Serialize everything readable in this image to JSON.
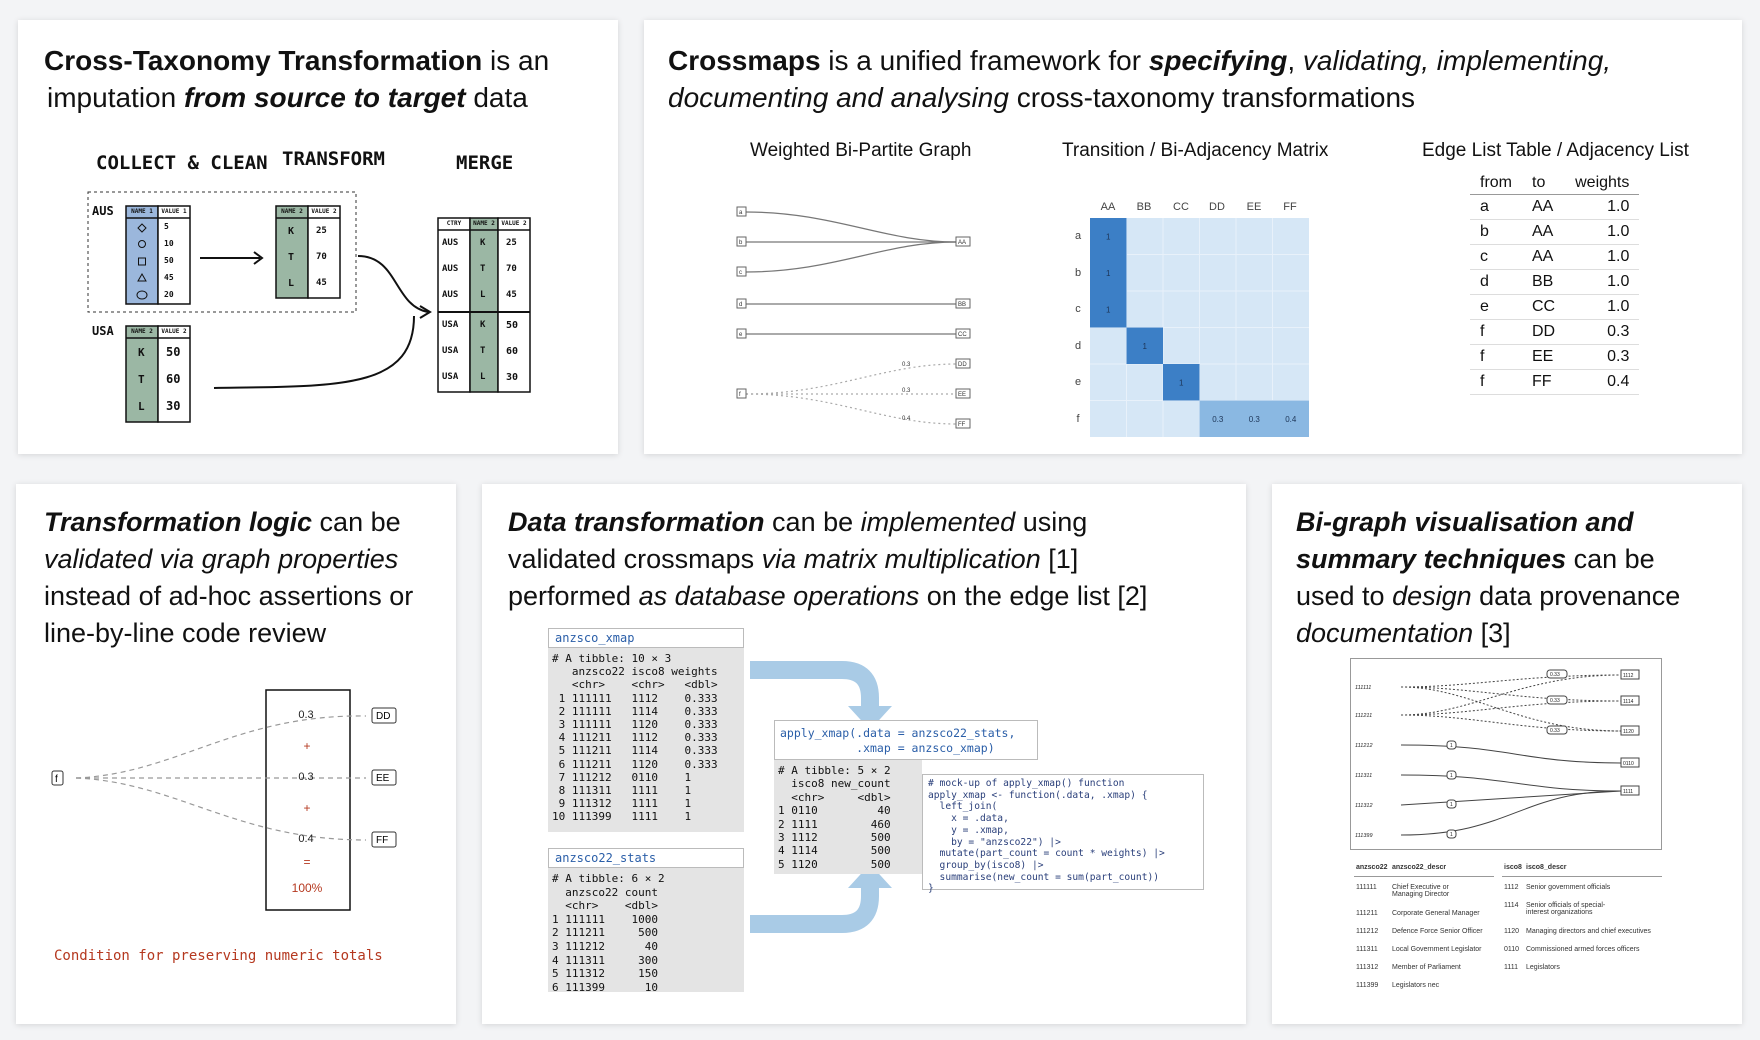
{
  "panel1": {
    "title_strong": "Cross-Taxonomy Transformation",
    "title_rest1": " is an",
    "title_rest2": "imputation ",
    "title_em": "from source to target",
    "title_rest3": " data",
    "stage_collect": "COLLECT & CLEAN",
    "stage_transform": "TRANSFORM",
    "stage_merge": "MERGE",
    "label_aus": "AUS",
    "label_usa": "USA",
    "col_name1": "NAME 1",
    "col_value1": "VALUE 1",
    "col_name2": "NAME 2",
    "col_value2": "VALUE 2",
    "col_ctry": "CTRY",
    "aus_values": [
      "5",
      "10",
      "50",
      "45",
      "20"
    ],
    "aus_transformed": [
      {
        "k": "K",
        "v": "25"
      },
      {
        "k": "T",
        "v": "70"
      },
      {
        "k": "L",
        "v": "45"
      }
    ],
    "usa_rows": [
      {
        "k": "K",
        "v": "50"
      },
      {
        "k": "T",
        "v": "60"
      },
      {
        "k": "L",
        "v": "30"
      }
    ],
    "merge_rows": [
      {
        "c": "AUS",
        "k": "K",
        "v": "25"
      },
      {
        "c": "AUS",
        "k": "T",
        "v": "70"
      },
      {
        "c": "AUS",
        "k": "L",
        "v": "45"
      },
      {
        "c": "USA",
        "k": "K",
        "v": "50"
      },
      {
        "c": "USA",
        "k": "T",
        "v": "60"
      },
      {
        "c": "USA",
        "k": "L",
        "v": "30"
      }
    ]
  },
  "panel2": {
    "title_strong": "Crossmaps",
    "title_a": " is a unified framework for ",
    "title_b": "specifying",
    "title_c": ", ",
    "title_d": "validating, implementing,",
    "title_e": "documenting and analysing",
    "title_f": " cross-taxonomy transformations",
    "graph_title": "Weighted Bi-Partite Graph",
    "matrix_title": "Transition / Bi-Adjacency Matrix",
    "table_title": "Edge List Table / Adjacency List",
    "sources": [
      "a",
      "b",
      "c",
      "d",
      "e",
      "f"
    ],
    "targets": [
      "AA",
      "BB",
      "CC",
      "DD",
      "EE",
      "FF"
    ],
    "edge_weights_f": [
      "0.3",
      "0.3",
      "0.4"
    ],
    "matrix_cells": [
      {
        "r": 0,
        "c": 0,
        "v": "1"
      },
      {
        "r": 1,
        "c": 0,
        "v": "1"
      },
      {
        "r": 2,
        "c": 0,
        "v": "1"
      },
      {
        "r": 3,
        "c": 1,
        "v": "1"
      },
      {
        "r": 4,
        "c": 2,
        "v": "1"
      },
      {
        "r": 5,
        "c": 3,
        "v": "0.3"
      },
      {
        "r": 5,
        "c": 4,
        "v": "0.3"
      },
      {
        "r": 5,
        "c": 5,
        "v": "0.4"
      }
    ],
    "edge_table_headers": [
      "from",
      "to",
      "weights"
    ],
    "edge_table_rows": [
      [
        "a",
        "AA",
        "1.0"
      ],
      [
        "b",
        "AA",
        "1.0"
      ],
      [
        "c",
        "AA",
        "1.0"
      ],
      [
        "d",
        "BB",
        "1.0"
      ],
      [
        "e",
        "CC",
        "1.0"
      ],
      [
        "f",
        "DD",
        "0.3"
      ],
      [
        "f",
        "EE",
        "0.3"
      ],
      [
        "f",
        "FF",
        "0.4"
      ]
    ]
  },
  "panel3": {
    "l1_strong": "Transformation logic",
    "l1_rest": " can be",
    "l2_em": "validated via graph properties",
    "l3": "instead of ad-hoc assertions or",
    "l4": "line-by-line code review",
    "source_node": "f",
    "targets": [
      "DD",
      "EE",
      "FF"
    ],
    "weights": [
      "0.3",
      "0.3",
      "0.4"
    ],
    "plus": "+",
    "equals": "=",
    "total": "100%",
    "caption": "Condition for preserving numeric totals"
  },
  "panel4": {
    "l1_strong": "Data transformation",
    "l1_a": " can be ",
    "l1_em": "implemented",
    "l1_b": " using",
    "l2_a": "validated crossmaps ",
    "l2_em": "via matrix multiplication",
    "l2_b": " [1]",
    "l3_a": "performed ",
    "l3_em": "as database operations",
    "l3_b": " on the edge list [2]",
    "xmap_header": "anzsco_xmap",
    "xmap_body": "# A tibble: 10 × 3\n   anzsco22 isco8 weights\n   <chr>    <chr>   <dbl>\n 1 111111   1112    0.333\n 2 111111   1114    0.333\n 3 111111   1120    0.333\n 4 111211   1112    0.333\n 5 111211   1114    0.333\n 6 111211   1120    0.333\n 7 111212   0110    1\n 8 111311   1111    1\n 9 111312   1111    1\n10 111399   1111    1",
    "stats_header": "anzsco22_stats",
    "stats_body": "# A tibble: 6 × 2\n  anzsco22 count\n  <chr>    <dbl>\n1 111111    1000\n2 111211     500\n3 111212      40\n4 111311     300\n5 111312     150\n6 111399      10",
    "call_l1": "apply_xmap(.data = anzsco22_stats,",
    "call_l2": "           .xmap = anzsco_xmap)",
    "result_body": "# A tibble: 5 × 2\n  isco8 new_count\n  <chr>     <dbl>\n1 0110         40\n2 1111        460\n3 1112        500\n4 1114        500\n5 1120        500",
    "fn_body": "# mock-up of apply_xmap() function\napply_xmap <- function(.data, .xmap) {\n  left_join(\n    x = .data,\n    y = .xmap,\n    by = \"anzsco22\") |>\n  mutate(part_count = count * weights) |>\n  group_by(isco8) |>\n  summarise(new_count = sum(part_count))\n}"
  },
  "panel5": {
    "l1_bi": "Bi-graph visualisation and",
    "l2_bi": "summary techniques",
    "l2_rest": " can be",
    "l3_a": "used to ",
    "l3_em": "design",
    "l3_b": " data provenance",
    "l4_em": "documentation",
    "l4_b": " [3]",
    "bigraph_sources": [
      "111111",
      "111211",
      "111212",
      "111311",
      "111312",
      "111399"
    ],
    "bigraph_targets": [
      "1112",
      "1114",
      "1120",
      "0110",
      "1111"
    ],
    "bigraph_weight": "0.33",
    "bigraph_one": "1",
    "left_headers": [
      "anzsco22",
      "anzsco22_descr"
    ],
    "left_rows": [
      [
        "111111",
        "Chief Executive or Managing Director"
      ],
      [
        "111211",
        "Corporate General Manager"
      ],
      [
        "111212",
        "Defence Force Senior Officer"
      ],
      [
        "111311",
        "Local Government Legislator"
      ],
      [
        "111312",
        "Member of Parliament"
      ],
      [
        "111399",
        "Legislators nec"
      ]
    ],
    "right_headers": [
      "isco8",
      "isco8_descr"
    ],
    "right_rows": [
      [
        "1112",
        "Senior government officials"
      ],
      [
        "1114",
        "Senior officials of special-interest organizations"
      ],
      [
        "1120",
        "Managing directors and chief executives"
      ],
      [
        "0110",
        "Commissioned armed forces officers"
      ],
      [
        "1111",
        "Legislators"
      ]
    ]
  },
  "colors": {
    "matrix_dark": "#3c7fc6",
    "matrix_mid": "#8ab8e2",
    "matrix_light": "#d6e7f6",
    "flow_arrow": "#a9cbe6",
    "accent_red": "#b5381f",
    "code_blue": "#2a5ea8",
    "code_purple": "#9b3fb8"
  }
}
